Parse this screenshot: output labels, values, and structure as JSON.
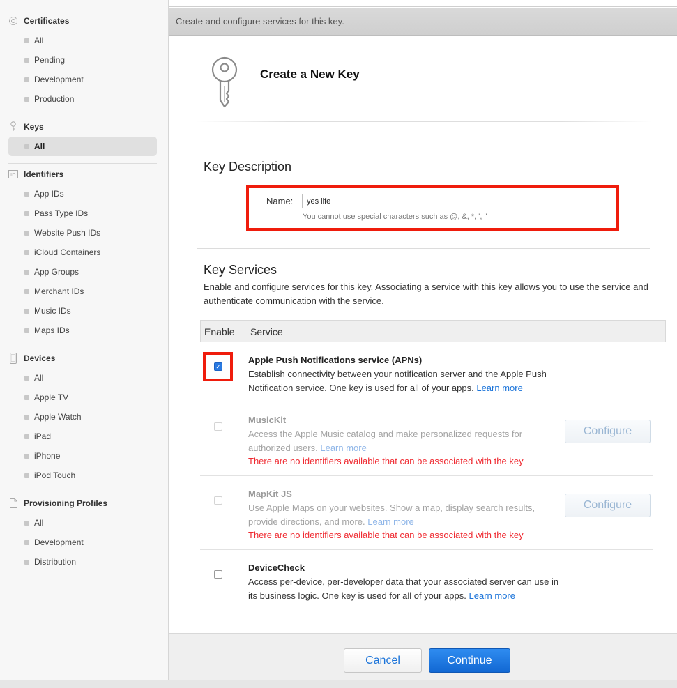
{
  "sidebar": {
    "certificates": {
      "label": "Certificates",
      "icon": "gear-badge-icon",
      "items": [
        "All",
        "Pending",
        "Development",
        "Production"
      ]
    },
    "keys": {
      "label": "Keys",
      "icon": "key-icon",
      "items": [
        "All"
      ],
      "active": "All"
    },
    "identifiers": {
      "label": "Identifiers",
      "icon": "id-icon",
      "items": [
        "App IDs",
        "Pass Type IDs",
        "Website Push IDs",
        "iCloud Containers",
        "App Groups",
        "Merchant IDs",
        "Music IDs",
        "Maps IDs"
      ]
    },
    "devices": {
      "label": "Devices",
      "icon": "device-icon",
      "items": [
        "All",
        "Apple TV",
        "Apple Watch",
        "iPad",
        "iPhone",
        "iPod Touch"
      ]
    },
    "profiles": {
      "label": "Provisioning Profiles",
      "icon": "document-icon",
      "items": [
        "All",
        "Development",
        "Distribution"
      ]
    }
  },
  "header": {
    "subtitle": "Create and configure services for this key."
  },
  "page": {
    "title": "Create a New Key"
  },
  "key_description": {
    "heading": "Key Description",
    "name_label": "Name:",
    "name_value": "yes life",
    "hint": "You cannot use special characters such as @, &, *, ', \""
  },
  "key_services": {
    "heading": "Key Services",
    "description": "Enable and configure services for this key. Associating a service with this key allows you to use the service and authenticate communication with the service.",
    "col_enable": "Enable",
    "col_service": "Service",
    "services": [
      {
        "title": "Apple Push Notifications service (APNs)",
        "text": "Establish connectivity between your notification server and the Apple Push Notification service. One key is used for all of your apps.",
        "link": "Learn more",
        "checked": true,
        "disabled": false
      },
      {
        "title": "MusicKit",
        "text": "Access the Apple Music catalog and make personalized requests for authorized users.",
        "link": "Learn more",
        "error": "There are no identifiers available that can be associated with the key",
        "button": "Configure",
        "checked": false,
        "disabled": true
      },
      {
        "title": "MapKit JS",
        "text": "Use Apple Maps on your websites. Show a map, display search results, provide directions, and more.",
        "link": "Learn more",
        "error": "There are no identifiers available that can be associated with the key",
        "button": "Configure",
        "checked": false,
        "disabled": true
      },
      {
        "title": "DeviceCheck",
        "text": "Access per-device, per-developer data that your associated server can use in its business logic. One key is used for all of your apps.",
        "link": "Learn more",
        "checked": false,
        "disabled": false
      }
    ]
  },
  "footer": {
    "cancel": "Cancel",
    "continue": "Continue"
  },
  "colors": {
    "accent": "#1a73d9",
    "highlight": "#ef1c0c",
    "error": "#ef2b32",
    "primary_button": "#1268d3"
  }
}
